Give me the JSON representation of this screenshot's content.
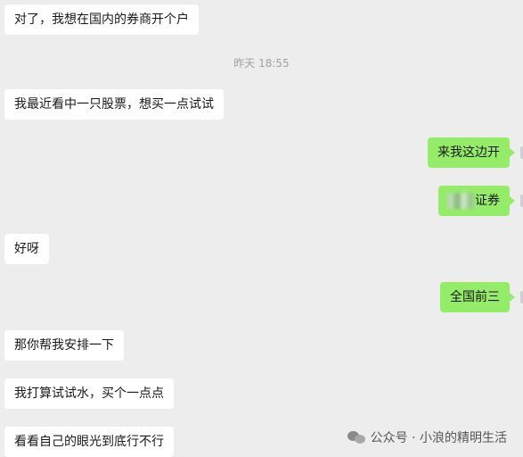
{
  "messages": [
    {
      "side": "left",
      "text": "对了，我想在国内的券商开个户"
    },
    {
      "side": "left",
      "text": "我最近看中一只股票，想买一点试试"
    },
    {
      "side": "right",
      "text": "来我这边开"
    },
    {
      "side": "right",
      "text": "证券"
    },
    {
      "side": "left",
      "text": "好呀"
    },
    {
      "side": "right",
      "text": "全国前三"
    },
    {
      "side": "left",
      "text": "那你帮我安排一下"
    },
    {
      "side": "left",
      "text": "我打算试试水，买个一点点"
    },
    {
      "side": "left",
      "text": "看看自己的眼光到底行不行"
    }
  ],
  "timestamp": "昨天 18:55",
  "watermark": "公众号 · 小浪的精明生活",
  "watermark_icon": "wechat-bubbles-icon",
  "colors": {
    "background": "#ededed",
    "incoming_bubble": "#ffffff",
    "outgoing_bubble": "#95ec69",
    "timestamp": "#a0a0a0"
  }
}
